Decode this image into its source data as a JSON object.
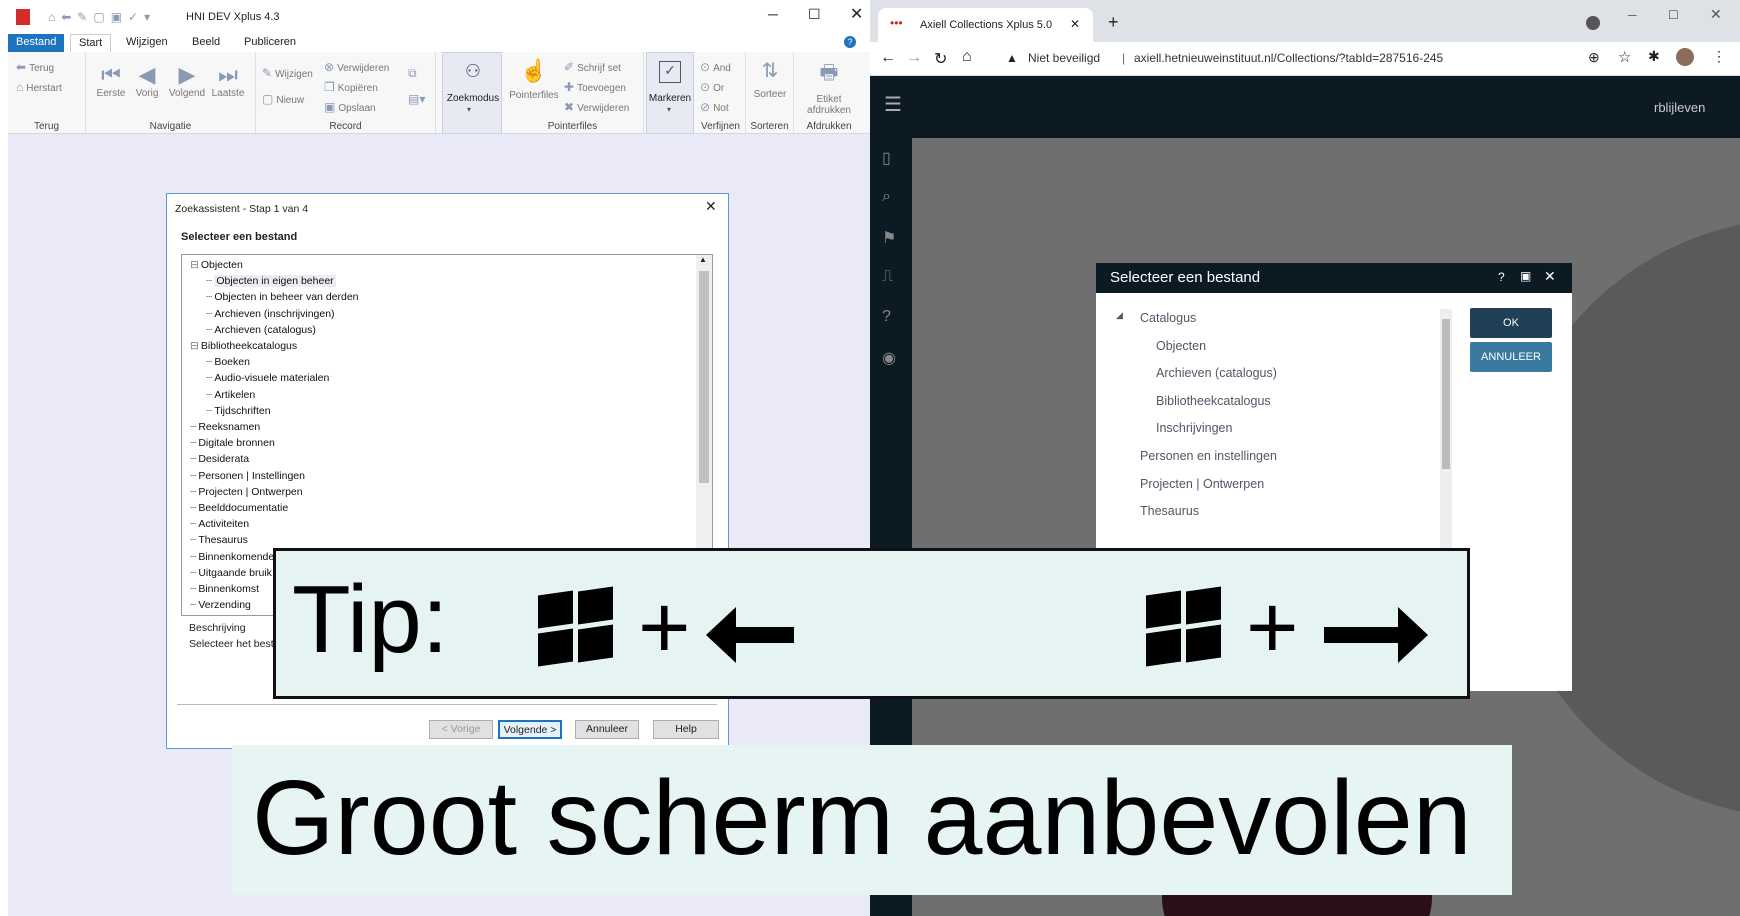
{
  "left_app": {
    "title": "HNI DEV Xplus 4.3",
    "tabs": [
      {
        "label": "Bestand"
      },
      {
        "label": "Start"
      },
      {
        "label": "Wijzigen"
      },
      {
        "label": "Beeld"
      },
      {
        "label": "Publiceren"
      }
    ],
    "ribbon": {
      "terug_group": {
        "terug": "Terug",
        "herstart": "Herstart",
        "label": "Terug"
      },
      "navigatie_group": {
        "eerste": "Eerste",
        "vorig": "Vorig",
        "volgend": "Volgend",
        "laatste": "Laatste",
        "label": "Navigatie"
      },
      "record_group": {
        "wijzigen": "Wijzigen",
        "nieuw": "Nieuw",
        "verwijderen": "Verwijderen",
        "kopieren": "Kopiëren",
        "opslaan": "Opslaan",
        "label": "Record"
      },
      "zoekmodus": "Zoekmodus",
      "pointerfiles_group": {
        "pointerfiles": "Pointerfiles",
        "schrijf_set": "Schrijf set",
        "toevoegen": "Toevoegen",
        "verwijderen": "Verwijderen",
        "label": "Pointerfiles"
      },
      "markeren": "Markeren",
      "verfijnen_group": {
        "and": "And",
        "or": "Or",
        "not": "Not",
        "label": "Verfijnen"
      },
      "sorteren_group": {
        "sorteer": "Sorteer",
        "label": "Sorteren"
      },
      "afdrukken_group": {
        "etiket": "Etiket",
        "afdrukken": "afdrukken",
        "label": "Afdrukken"
      }
    },
    "dialog": {
      "title": "Zoekassistent - Stap 1 van 4",
      "heading": "Selecteer een bestand",
      "tree": [
        {
          "label": "Objecten",
          "level": 0,
          "expanded": true
        },
        {
          "label": "Objecten in eigen beheer",
          "level": 1,
          "selected": true
        },
        {
          "label": "Objecten in beheer van derden",
          "level": 1
        },
        {
          "label": "Archieven (inschrijvingen)",
          "level": 1
        },
        {
          "label": "Archieven (catalogus)",
          "level": 1
        },
        {
          "label": "Bibliotheekcatalogus",
          "level": 0,
          "expanded": true
        },
        {
          "label": "Boeken",
          "level": 1
        },
        {
          "label": "Audio-visuele materialen",
          "level": 1
        },
        {
          "label": "Artikelen",
          "level": 1
        },
        {
          "label": "Tijdschriften",
          "level": 1
        },
        {
          "label": "Reeksnamen",
          "level": 0
        },
        {
          "label": "Digitale bronnen",
          "level": 0
        },
        {
          "label": "Desiderata",
          "level": 0
        },
        {
          "label": "Personen | Instellingen",
          "level": 0
        },
        {
          "label": "Projecten | Ontwerpen",
          "level": 0
        },
        {
          "label": "Beelddocumentatie",
          "level": 0
        },
        {
          "label": "Activiteiten",
          "level": 0
        },
        {
          "label": "Thesaurus",
          "level": 0
        },
        {
          "label": "Binnenkomende",
          "level": 0
        },
        {
          "label": "Uitgaande bruik",
          "level": 0
        },
        {
          "label": "Binnenkomst",
          "level": 0
        },
        {
          "label": "Verzending",
          "level": 0
        }
      ],
      "description_label": "Beschrijving",
      "description_text": "Selecteer het bestan",
      "buttons": {
        "prev": "< Vorige",
        "next": "Volgende >",
        "cancel": "Annuleer",
        "help": "Help"
      }
    }
  },
  "browser": {
    "tab_title": "Axiell Collections Xplus 5.0",
    "security_label": "Niet beveiligd",
    "url": "axiell.hetnieuweinstituut.nl/Collections/?tabId=287516-245",
    "user": "rblijleven",
    "modal": {
      "title": "Selecteer een bestand",
      "items": [
        {
          "label": "Catalogus",
          "level": 0,
          "expanded": true
        },
        {
          "label": "Objecten",
          "level": 1
        },
        {
          "label": "Archieven (catalogus)",
          "level": 1
        },
        {
          "label": "Bibliotheekcatalogus",
          "level": 1
        },
        {
          "label": "Inschrijvingen",
          "level": 1
        },
        {
          "label": "Personen en instellingen",
          "level": 0
        },
        {
          "label": "Projecten | Ontwerpen",
          "level": 0
        },
        {
          "label": "Thesaurus",
          "level": 0
        }
      ],
      "ok": "OK",
      "cancel": "ANNULEER"
    }
  },
  "overlay": {
    "tip_label": "Tip:",
    "plus": "+",
    "banner": "Groot scherm aanbevolen"
  },
  "colors": {
    "accent": "#1e73be",
    "app_dark": "#0c1a24",
    "button_dark": "#1f4056"
  }
}
